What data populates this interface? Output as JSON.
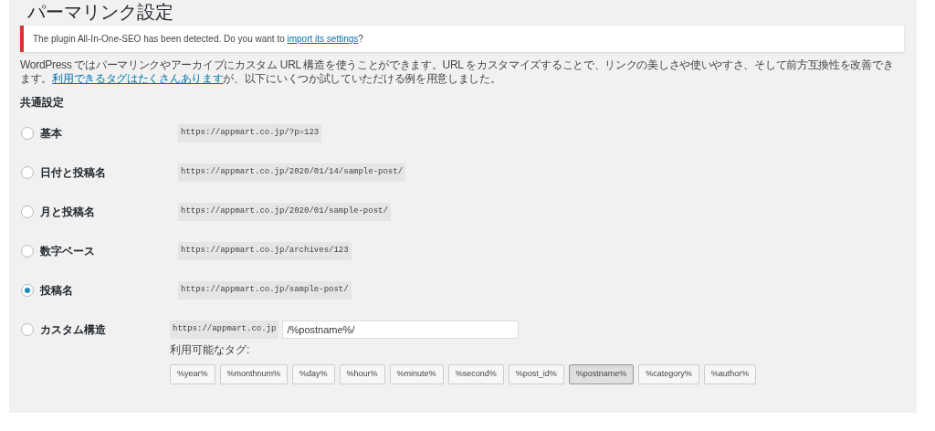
{
  "title": "パーマリンク設定",
  "notice": {
    "text": "The plugin All-In-One-SEO has been detected. Do you want to ",
    "link": "import its settings",
    "after": "?"
  },
  "description": {
    "text": "WordPress ではパーマリンクやアーカイブにカスタム URL 構造を使うことができます。URL をカスタマイズすることで、リンクの美しさや使いやすさ、そして前方互換性を改善できます。",
    "link": "利用できるタグはたくさんあります",
    "after": "が、以下にいくつか試していただける例を用意しました。"
  },
  "section_heading": "共通設定",
  "options": [
    {
      "kind": "preset",
      "label": "基本",
      "url": "https://appmart.co.jp/?p=123",
      "selected": false
    },
    {
      "kind": "preset",
      "label": "日付と投稿名",
      "url": "https://appmart.co.jp/2020/01/14/sample-post/",
      "selected": false
    },
    {
      "kind": "preset",
      "label": "月と投稿名",
      "url": "https://appmart.co.jp/2020/01/sample-post/",
      "selected": false
    },
    {
      "kind": "preset",
      "label": "数字ベース",
      "url": "https://appmart.co.jp/archives/123",
      "selected": false
    },
    {
      "kind": "preset",
      "label": "投稿名",
      "url": "https://appmart.co.jp/sample-post/",
      "selected": true
    },
    {
      "kind": "custom",
      "label": "カスタム構造",
      "url": "https://appmart.co.jp",
      "value": "/%postname%/",
      "selected": false
    }
  ],
  "tags_label": "利用可能なタグ:",
  "tags": [
    {
      "label": "%year%",
      "selected": false
    },
    {
      "label": "%monthnum%",
      "selected": false
    },
    {
      "label": "%day%",
      "selected": false
    },
    {
      "label": "%hour%",
      "selected": false
    },
    {
      "label": "%minute%",
      "selected": false
    },
    {
      "label": "%second%",
      "selected": false
    },
    {
      "label": "%post_id%",
      "selected": false
    },
    {
      "label": "%postname%",
      "selected": true
    },
    {
      "label": "%category%",
      "selected": false
    },
    {
      "label": "%author%",
      "selected": false
    }
  ]
}
